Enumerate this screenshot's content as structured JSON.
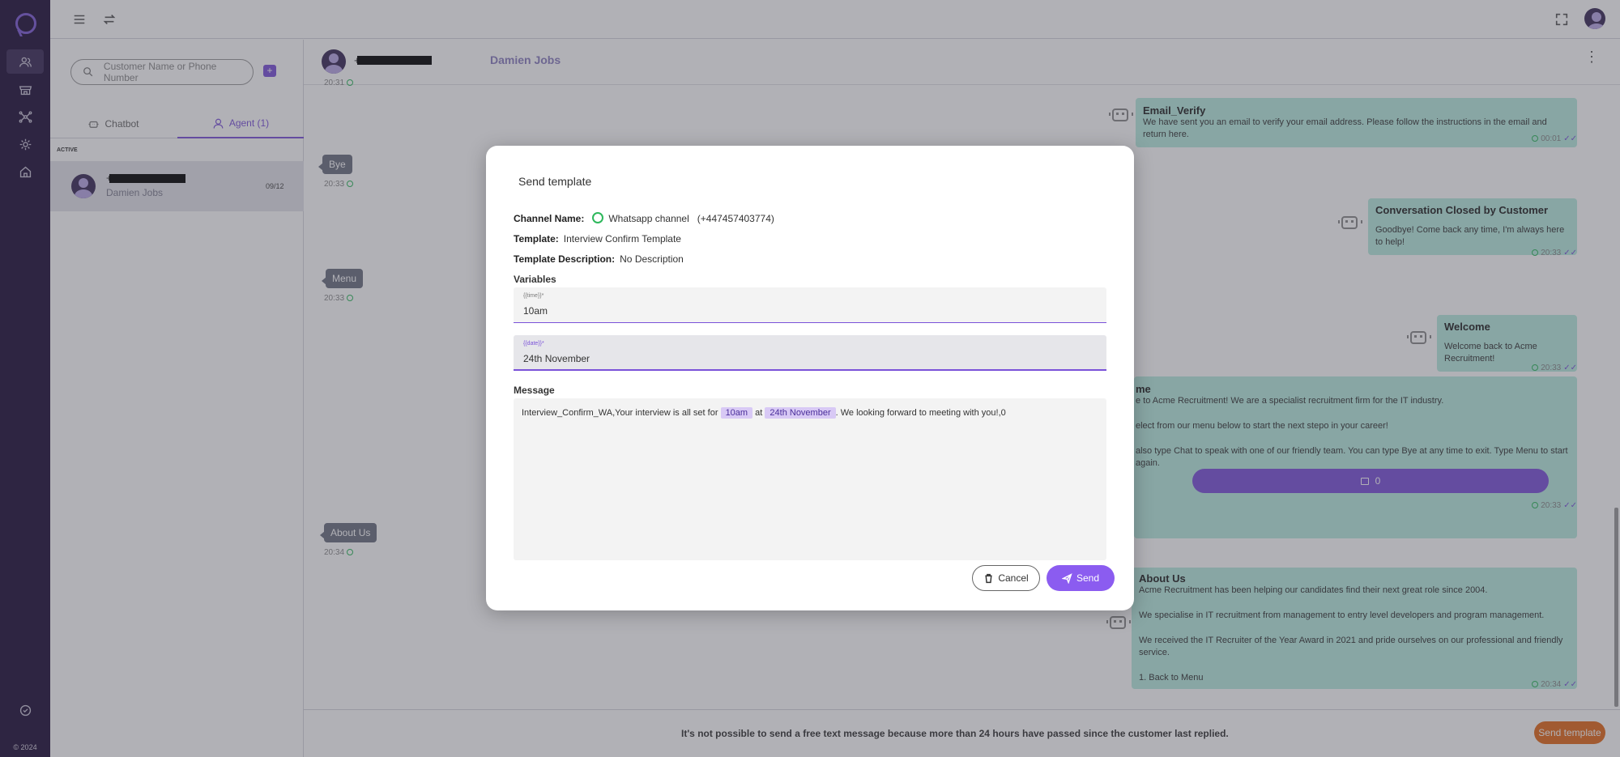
{
  "rail": {
    "items": [
      "customers-icon",
      "store-icon",
      "network-icon",
      "settings-icon",
      "home-icon"
    ],
    "bottom_icon": "check-circle-icon",
    "copyright": "© 2024"
  },
  "topbar": {
    "icons": [
      "menu-icon",
      "swap-icon",
      "fullscreen-icon",
      "account-icon"
    ]
  },
  "conversations": {
    "search_placeholder": "Customer Name or Phone Number",
    "tabs": [
      {
        "label": "Chatbot",
        "icon": "robot-icon"
      },
      {
        "label": "Agent (1)",
        "icon": "agent-icon",
        "active": true
      }
    ],
    "section": "ACTIVE",
    "items": [
      {
        "name": "Damien Jobs",
        "date": "09/12",
        "phone_prefix": "+"
      }
    ]
  },
  "chat": {
    "phone_prefix": "+",
    "customer_name": "Damien Jobs",
    "top_time": "20:31",
    "user_messages": [
      {
        "text": "Bye",
        "time": "20:33"
      },
      {
        "text": "Menu",
        "time": "20:33"
      },
      {
        "text": "About Us",
        "time": "20:34"
      }
    ],
    "bot_messages": [
      {
        "title": "Email_Verify",
        "lines": [
          "We have sent you an email to verify your email address. Please follow the instructions in the email and return here."
        ],
        "time": "00:01"
      },
      {
        "title": "Conversation Closed by Customer",
        "lines": [
          "Goodbye! Come back any time, I'm always here to help!"
        ],
        "time": "20:33"
      },
      {
        "title": "Welcome",
        "lines": [
          "Welcome back to Acme Recruitment!"
        ],
        "time": "20:33"
      },
      {
        "title": "me",
        "lines": [
          "e to Acme Recruitment! We are a specialist recruitment firm for the IT industry.",
          "elect from our menu below to start the next stepo in your career!",
          "also type Chat to speak with one of our friendly team. You can type Bye at any time to exit. Type Menu to start again."
        ],
        "button_label": "0",
        "time": "20:33"
      },
      {
        "title": "About Us",
        "lines": [
          "Acme Recruitment has been helping our candidates find their next great role since 2004.",
          "We specialise in IT recruitment from management to entry level developers and program management.",
          "We received the IT Recruiter of the Year Award in 2021 and pride ourselves on our professional and friendly service.",
          "1.  Back to Menu"
        ],
        "time": "20:34"
      }
    ],
    "footer_notice": "It's not possible to send a free text message because more than 24 hours have passed since the customer last replied.",
    "send_template_label": "Send template"
  },
  "modal": {
    "title": "Send template",
    "channel_label": "Channel Name:",
    "channel_value": "Whatsapp channel",
    "channel_number": "(+447457403774)",
    "template_label": "Template:",
    "template_value": "Interview Confirm Template",
    "description_label": "Template Description:",
    "description_value": "No Description",
    "variables_label": "Variables",
    "variables": [
      {
        "label": "{{time}}*",
        "value": "10am"
      },
      {
        "label": "{{date}}*",
        "value": "24th November"
      }
    ],
    "message_label": "Message",
    "message": {
      "prefix": "Interview_Confirm_WA,Your interview is all set for",
      "var1": "10am",
      "middle": "at",
      "var2": "24th November",
      "suffix": ". We looking forward to meeting with you!,0"
    },
    "cancel_label": "Cancel",
    "send_label": "Send",
    "accent": "#8b5cf0"
  }
}
